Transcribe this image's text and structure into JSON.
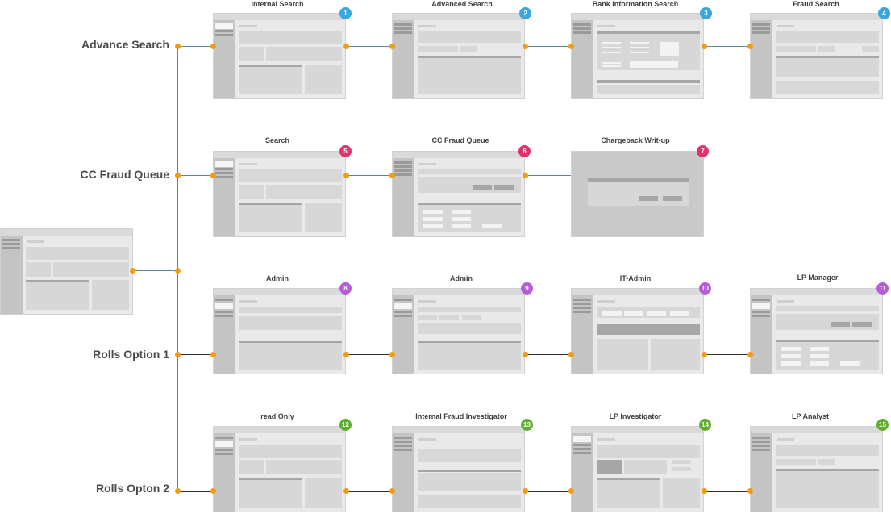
{
  "rows": [
    {
      "label": "Advance Search"
    },
    {
      "label": "CC Fraud Queue"
    },
    {
      "label": "Rolls Option 1"
    },
    {
      "label": "Rolls Opton 2"
    }
  ],
  "screens": [
    {
      "title": "Internal  Search",
      "num": "1",
      "badge_color": "#3aa6dd"
    },
    {
      "title": "Advanced Search",
      "num": "2",
      "badge_color": "#3aa6dd"
    },
    {
      "title": "Bank Information Search",
      "num": "3",
      "badge_color": "#3aa6dd"
    },
    {
      "title": "Fraud Search",
      "num": "4",
      "badge_color": "#3aa6dd"
    },
    {
      "title": "Search",
      "num": "5",
      "badge_color": "#e0336b"
    },
    {
      "title": "CC Fraud Queue",
      "num": "6",
      "badge_color": "#e0336b"
    },
    {
      "title": "Chargeback Writ-up",
      "num": "7",
      "badge_color": "#e0336b"
    },
    {
      "title": "Admin",
      "num": "8",
      "badge_color": "#b45bd6"
    },
    {
      "title": "Admin",
      "num": "9",
      "badge_color": "#b45bd6"
    },
    {
      "title": "IT-Admin",
      "num": "10",
      "badge_color": "#b45bd6"
    },
    {
      "title": "LP Manager",
      "num": "11",
      "badge_color": "#b45bd6"
    },
    {
      "title": "read Only",
      "num": "12",
      "badge_color": "#5dae2e"
    },
    {
      "title": "Internal Fraud Investigator",
      "num": "13",
      "badge_color": "#5dae2e"
    },
    {
      "title": "LP Investigator",
      "num": "14",
      "badge_color": "#5dae2e"
    },
    {
      "title": "LP Analyst",
      "num": "15",
      "badge_color": "#5dae2e"
    }
  ],
  "colors": {
    "connector_dot": "#f39c12",
    "trunk_line": "#5a8a8f",
    "link_line": "#2d2d2d"
  }
}
